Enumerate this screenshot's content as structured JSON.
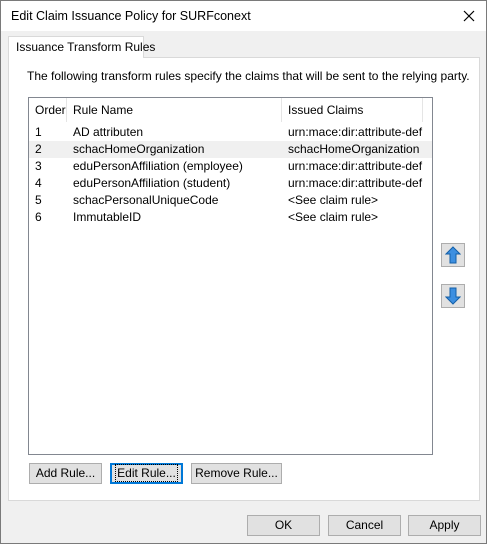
{
  "window": {
    "title": "Edit Claim Issuance Policy for SURFconext"
  },
  "tabs": [
    {
      "label": "Issuance Transform Rules"
    }
  ],
  "panel": {
    "description": "The following transform rules specify the claims that will be sent to the relying party."
  },
  "table": {
    "columns": [
      "Order",
      "Rule Name",
      "Issued Claims"
    ],
    "rows": [
      {
        "order": "1",
        "name": "AD attributen",
        "claims": "urn:mace:dir:attribute-def:..."
      },
      {
        "order": "2",
        "name": "schacHomeOrganization",
        "claims": "schacHomeOrganization"
      },
      {
        "order": "3",
        "name": "eduPersonAffiliation (employee)",
        "claims": "urn:mace:dir:attribute-def:..."
      },
      {
        "order": "4",
        "name": "eduPersonAffiliation (student)",
        "claims": "urn:mace:dir:attribute-def:..."
      },
      {
        "order": "5",
        "name": "schacPersonalUniqueCode",
        "claims": "<See claim rule>"
      },
      {
        "order": "6",
        "name": "ImmutableID",
        "claims": "<See claim rule>"
      }
    ],
    "selected_row": "2"
  },
  "side_buttons": {
    "up_icon": "arrow-up-icon",
    "down_icon": "arrow-down-icon"
  },
  "rule_buttons": {
    "add": "Add Rule...",
    "edit": "Edit Rule...",
    "remove": "Remove Rule..."
  },
  "footer": {
    "ok": "OK",
    "cancel": "Cancel",
    "apply": "Apply"
  },
  "colors": {
    "selection": "#f0f0f0",
    "arrow_blue": "#1e7fd6",
    "default_border": "#0078d7"
  }
}
